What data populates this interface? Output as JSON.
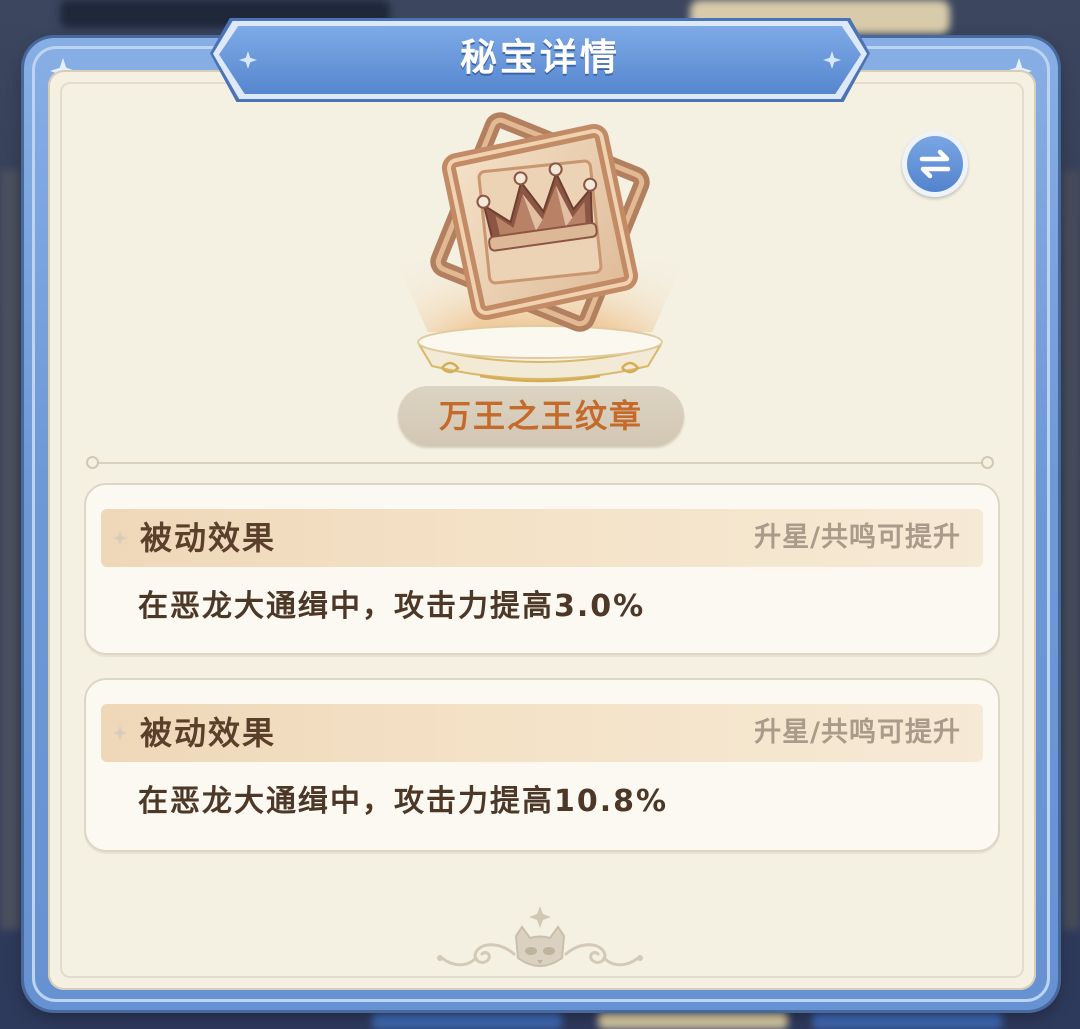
{
  "dialog": {
    "title": "秘宝详情"
  },
  "treasure": {
    "name": "万王之王纹章"
  },
  "effects": [
    {
      "label": "被动效果",
      "hint": "升星/共鸣可提升",
      "description": "在恶龙大通缉中，攻击力提高3.0%"
    },
    {
      "label": "被动效果",
      "hint": "升星/共鸣可提升",
      "description": "在恶龙大通缉中，攻击力提高10.8%"
    }
  ],
  "icons": {
    "swap_button": "swap-arrows-icon",
    "emblem": "crown-emblem-icon",
    "effect_bullet": "diamond-star-icon",
    "footer": "cat-face-ornament-icon",
    "corners": "four-point-star-icon"
  },
  "colors": {
    "frame_blue": "#6d99d7",
    "title_blue": "#5686cf",
    "panel_cream": "#f4f0e2",
    "treasure_name": "#c46b2b",
    "effect_header_bg": "#efd7b8",
    "effect_label": "#5a3f2b",
    "effect_hint": "#a99b89",
    "effect_text": "#4d3828"
  }
}
